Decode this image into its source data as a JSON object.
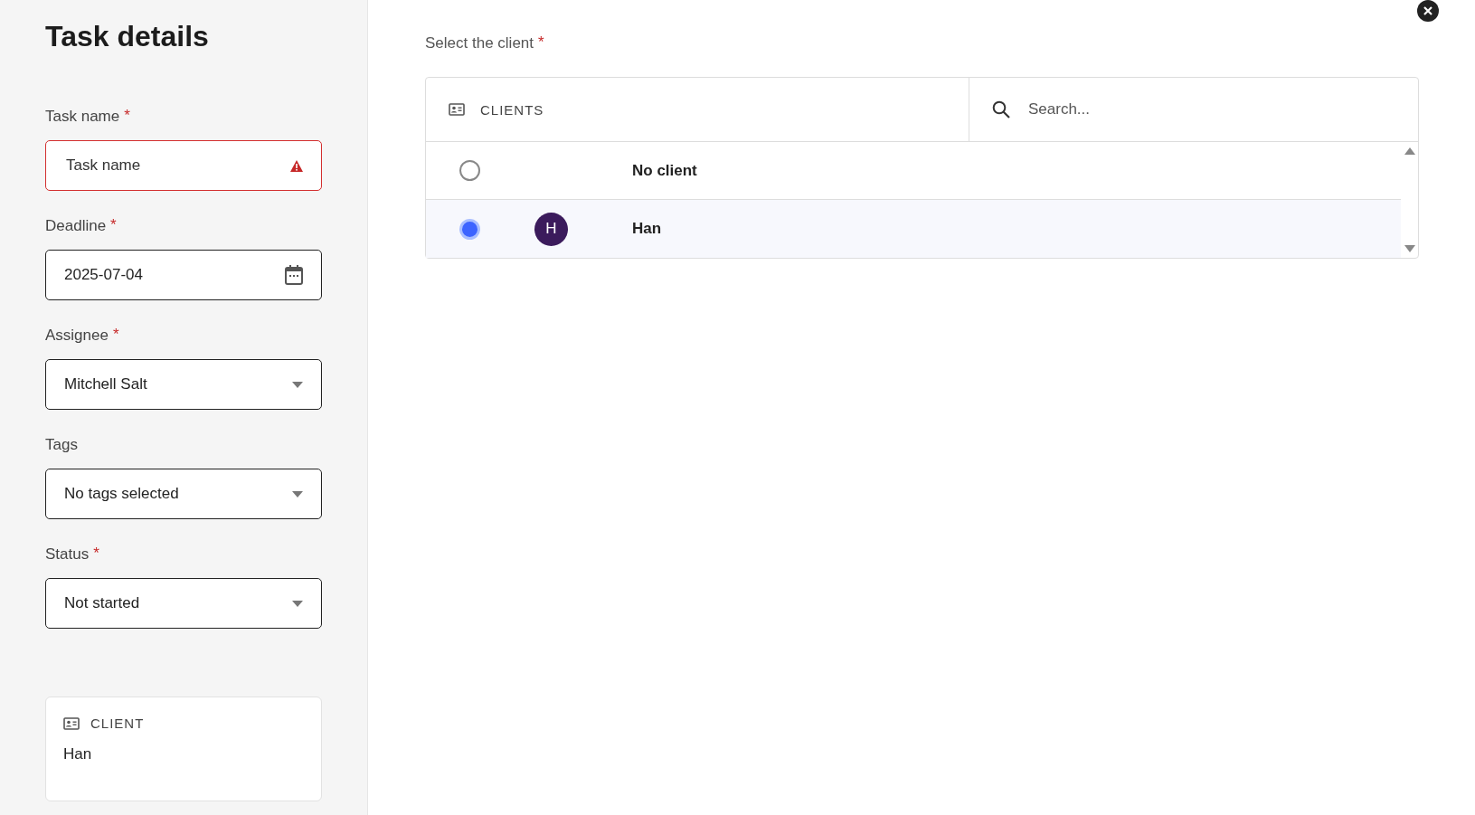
{
  "title": "Task details",
  "fields": [
    {
      "kind": "text",
      "label": "Task name",
      "required_mark": "*",
      "placeholder": "Task name",
      "error": true
    },
    {
      "kind": "date",
      "label": "Deadline",
      "required_mark": "*",
      "value": "2025-07-04",
      "error": false
    },
    {
      "kind": "select",
      "label": "Assignee",
      "required_mark": "*",
      "value": "Mitchell Salt",
      "error": false
    },
    {
      "kind": "select",
      "label": "Tags",
      "value": "No tags selected",
      "error": false
    },
    {
      "kind": "select",
      "label": "Status",
      "required_mark": "*",
      "value": "Not started",
      "error": false
    }
  ],
  "client_card": {
    "heading": "CLIENT",
    "value": "Han"
  },
  "client_picker": {
    "label": "Select the client",
    "required_mark": "*",
    "heading": "CLIENTS",
    "search": {
      "placeholder": "Search..."
    },
    "rows": [
      {
        "name": "No client",
        "selected": false
      },
      {
        "name": "Han",
        "selected": true,
        "avatar": "H"
      }
    ]
  }
}
